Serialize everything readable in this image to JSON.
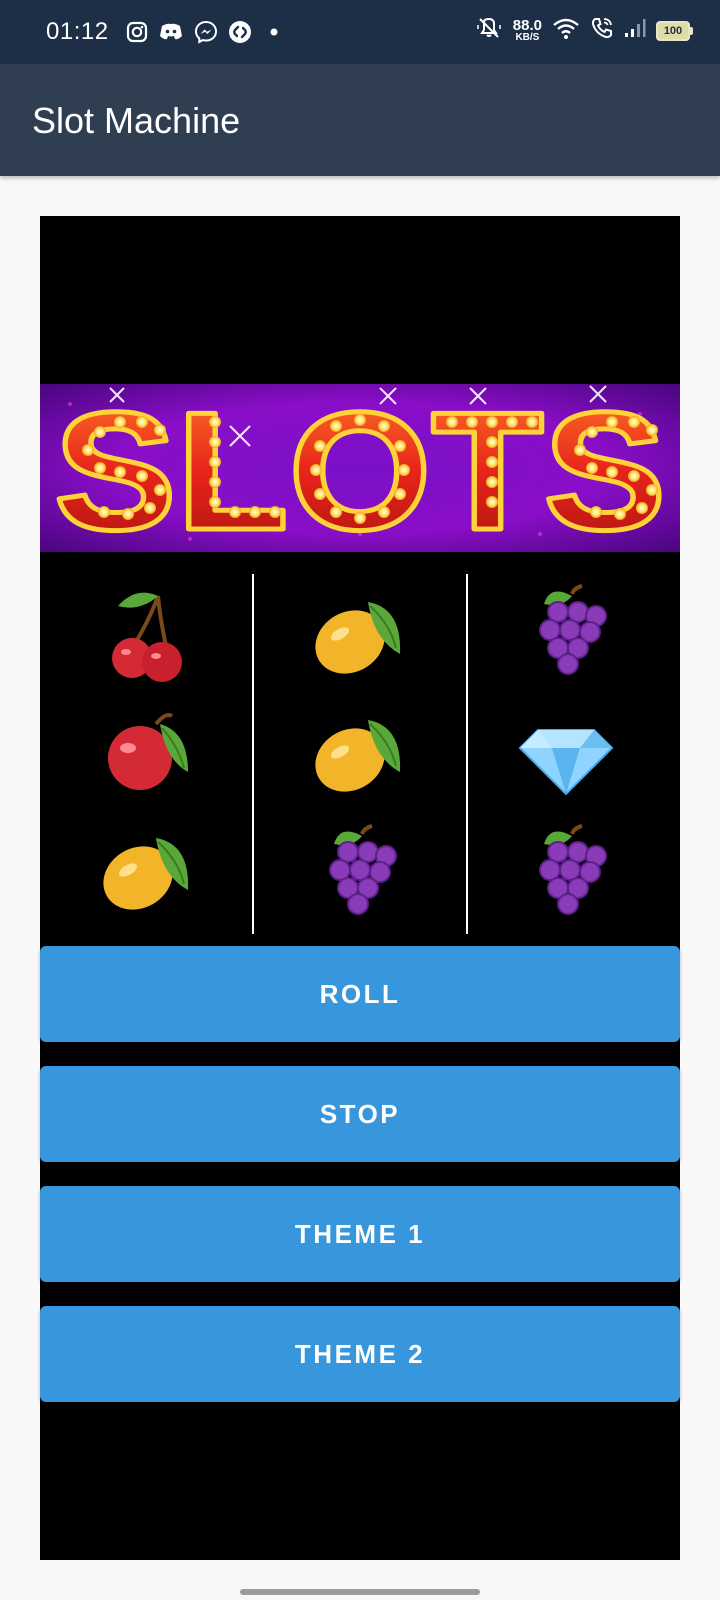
{
  "status_bar": {
    "time": "01:12",
    "net_speed_value": "88.0",
    "net_speed_unit": "KB/S",
    "battery": "100",
    "left_icons": [
      "instagram-icon",
      "discord-icon",
      "messenger-icon",
      "shazam-icon",
      "dot-icon"
    ],
    "right_icons": [
      "mute-icon",
      "wifi-icon",
      "wifi-calling-icon",
      "signal-icon",
      "battery-icon"
    ]
  },
  "app_bar": {
    "title": "Slot Machine"
  },
  "banner": {
    "text": "SLOTS"
  },
  "reels": [
    [
      "cherries",
      "apple",
      "lemon"
    ],
    [
      "lemon",
      "lemon",
      "grapes"
    ],
    [
      "grapes",
      "diamond",
      "grapes"
    ]
  ],
  "buttons": {
    "roll": "ROLL",
    "stop": "STOP",
    "theme1": "THEME 1",
    "theme2": "THEME 2"
  },
  "colors": {
    "status_bar": "#1c2f47",
    "app_bar": "#2f3e51",
    "button": "#3896dc",
    "panel": "#000000"
  }
}
